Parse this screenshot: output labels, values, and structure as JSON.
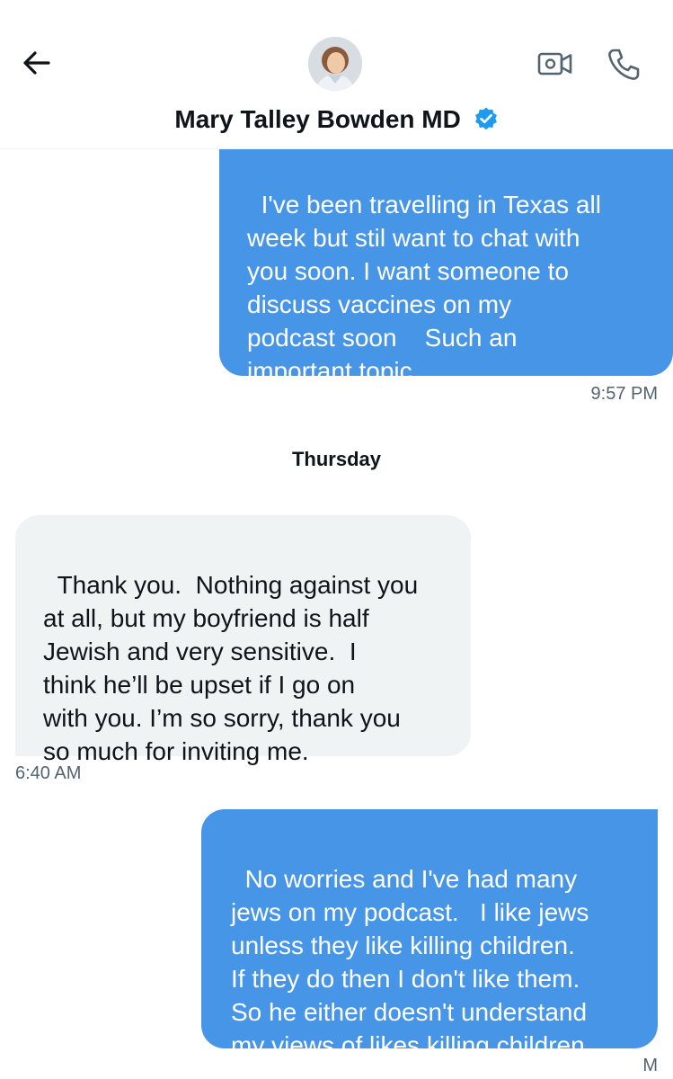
{
  "header": {
    "contact_name": "Mary Talley Bowden MD",
    "verified": true,
    "icons": [
      "back-arrow-icon",
      "avatar",
      "verified-badge-icon",
      "video-call-icon",
      "phone-call-icon"
    ]
  },
  "colors": {
    "outgoing_bubble": "#4795e7",
    "incoming_bubble": "#eff3f4",
    "verified_blue": "#1d9bf0",
    "timestamp": "#536471"
  },
  "messages": [
    {
      "direction": "outgoing",
      "text": "I've been travelling in Texas all\nweek but stil want to chat with\nyou soon. I want someone to\ndiscuss vaccines on my\npodcast soon    Such an\nimportant topic",
      "time": "9:57 PM"
    },
    {
      "direction": "separator",
      "text": "Thursday"
    },
    {
      "direction": "incoming",
      "text": "Thank you.  Nothing against you\nat all, but my boyfriend is half\nJewish and very sensitive.  I\nthink he’ll be upset if I go on\nwith you. I’m so sorry, thank you\nso much for inviting me.",
      "time": "6:40 AM"
    },
    {
      "direction": "outgoing",
      "text": "No worries and I've had many\njews on my podcast.   I like jews\nunless they like killing children.\nIf they do then I don't like them.\nSo he either doesn't understand\nmy views of likes killing children",
      "time": "M"
    }
  ]
}
